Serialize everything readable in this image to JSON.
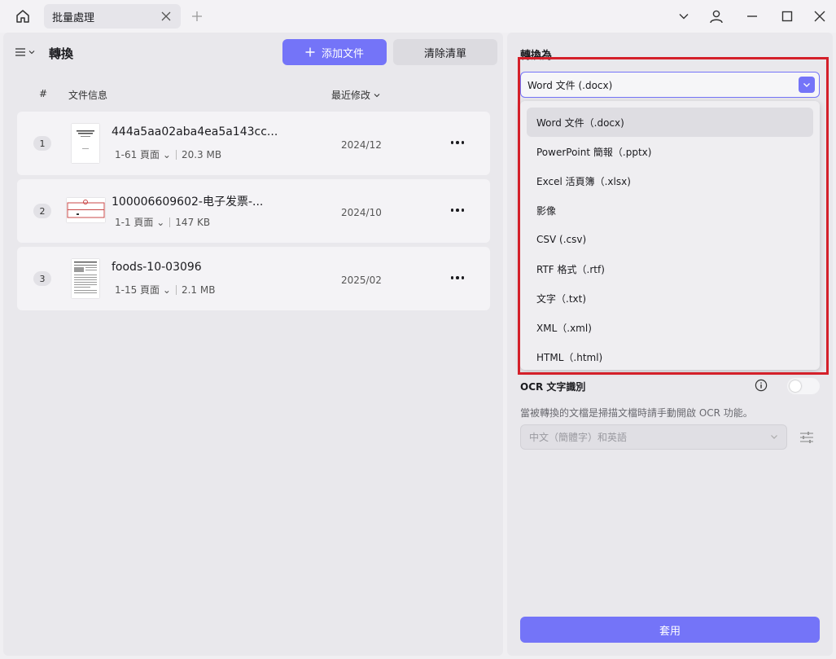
{
  "tab": {
    "label": "批量處理"
  },
  "left": {
    "title": "轉換",
    "add_label": "添加文件",
    "clear_label": "清除清單",
    "columns": {
      "num": "#",
      "info": "文件信息",
      "modified": "最近修改"
    },
    "files": [
      {
        "num": "1",
        "name": "444a5aa02aba4ea5a143cc...",
        "pages": "1-61 頁面",
        "size": "20.3 MB",
        "date": "2024/12"
      },
      {
        "num": "2",
        "name": "100006609602-电子发票-...",
        "pages": "1-1 頁面",
        "size": "147 KB",
        "date": "2024/10"
      },
      {
        "num": "3",
        "name": "foods-10-03096",
        "pages": "1-15 頁面",
        "size": "2.1 MB",
        "date": "2025/02"
      }
    ]
  },
  "right": {
    "convert_label": "轉換為",
    "selected": "Word 文件 (.docx)",
    "options": [
      "Word 文件（.docx)",
      "PowerPoint 簡報（.pptx)",
      "Excel 活頁簿（.xlsx)",
      "影像",
      "CSV (.csv)",
      "RTF 格式（.rtf)",
      "文字（.txt)",
      "XML（.xml)",
      "HTML（.html)"
    ],
    "ocr_label": "OCR 文字識別",
    "ocr_hint": "當被轉換的文檔是掃描文檔時請手動開啟 OCR 功能。",
    "ocr_enabled": false,
    "language": "中文（簡體字）和英語",
    "apply_label": "套用"
  },
  "colors": {
    "accent": "#7474f8",
    "highlight": "#d4202a"
  }
}
